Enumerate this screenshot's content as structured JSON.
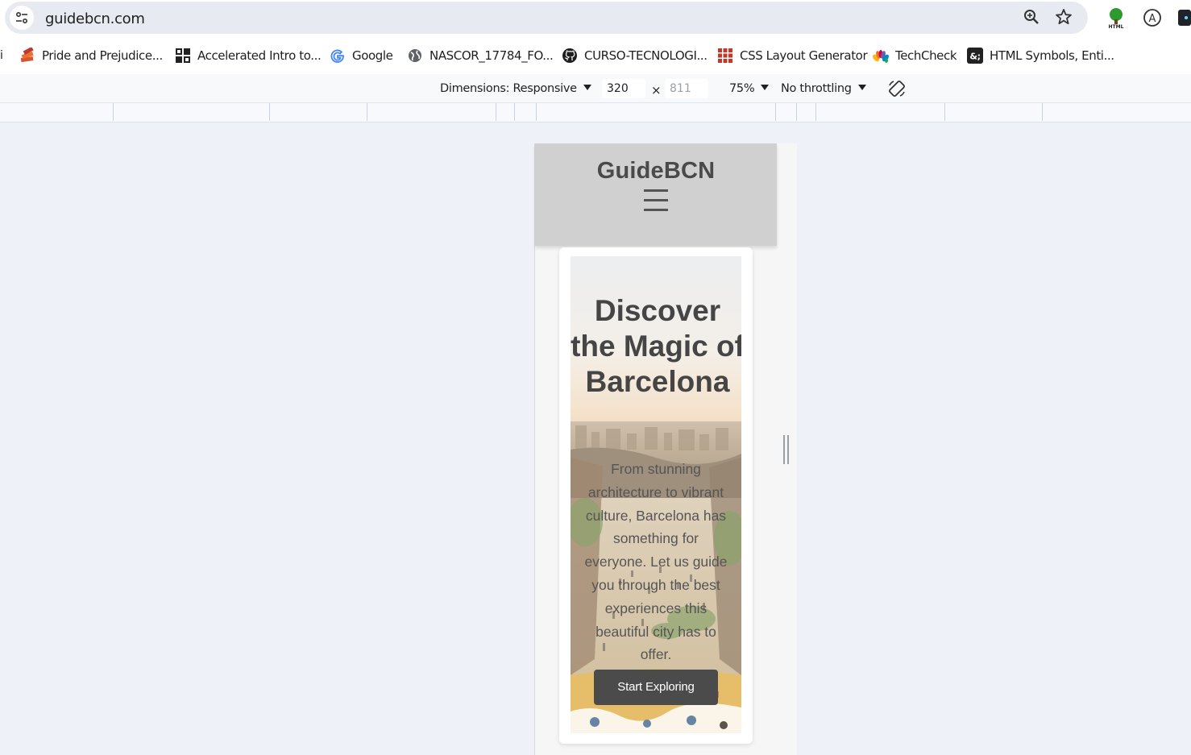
{
  "browser": {
    "url": "guidebcn.com",
    "bookmarks": [
      {
        "label": "Pride and Prejudice...",
        "icon": "book-stack-icon"
      },
      {
        "label": "Accelerated Intro to...",
        "icon": "code-grid-icon"
      },
      {
        "label": "Google",
        "icon": "google-icon"
      },
      {
        "label": "NASCOR_17784_FO...",
        "icon": "globe-icon"
      },
      {
        "label": "CURSO-TECNOLOGI...",
        "icon": "github-icon"
      },
      {
        "label": "CSS Layout Generator",
        "icon": "grid-icon"
      },
      {
        "label": "TechCheck",
        "icon": "nbc-peacock-icon"
      },
      {
        "label": "HTML Symbols, Enti...",
        "icon": "ampersand-icon"
      }
    ],
    "colors": {
      "accent": "#1a73e8",
      "toolbar_bg": "#e7ebf1"
    }
  },
  "device_toolbar": {
    "dimensions_label": "Dimensions: Responsive",
    "width": "320",
    "height_placeholder": "811",
    "times": "×",
    "zoom": "75%",
    "throttling": "No throttling"
  },
  "site": {
    "brand": "GuideBCN",
    "hero": {
      "title": "Discover the Magic of Barcelona",
      "text": "From stunning architecture to vibrant culture, Barcelona has something for everyone. Let us guide you through the best experiences this beautiful city has to offer.",
      "cta": "Start Exploring"
    },
    "colors": {
      "header_bg": "#d0d0d0",
      "button_bg": "#4b4b4b",
      "heading": "#454545"
    }
  }
}
